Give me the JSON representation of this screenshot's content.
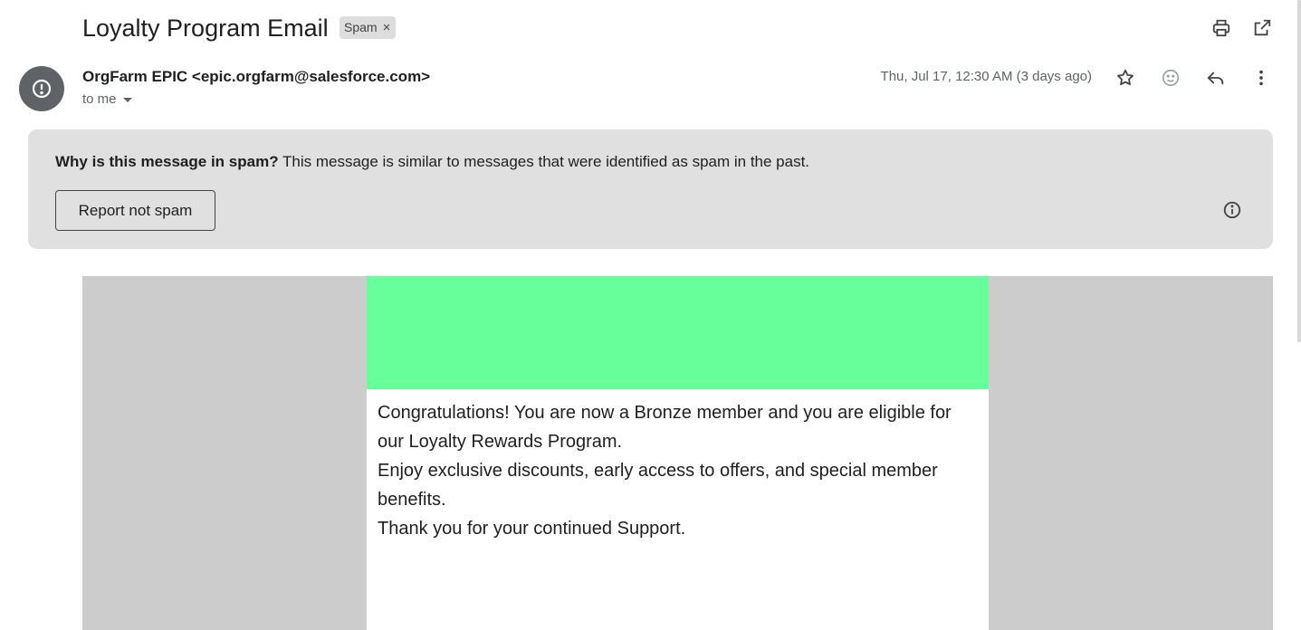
{
  "email": {
    "subject": "Loyalty Program Email",
    "label": "Spam",
    "label_remove": "×",
    "sender": "OrgFarm EPIC <epic.orgfarm@salesforce.com>",
    "recipient": "to me",
    "date": "Thu, Jul 17, 12:30 AM (3 days ago)"
  },
  "spam_banner": {
    "title": "Why is this message in spam?",
    "text": " This message is similar to messages that were identified as spam in the past.",
    "button": "Report not spam"
  },
  "body": {
    "hero_color": "#66ff99",
    "lines": [
      "Congratulations! You are now a Bronze member and you are eligible for our Loyalty Rewards Program.",
      "Enjoy exclusive discounts, early access to offers, and special member benefits.",
      "Thank you for your continued Support."
    ]
  },
  "icons": {
    "print": "printer-icon",
    "open_new": "open-in-new-window-icon",
    "star": "star-icon",
    "emoji": "emoji-reaction-icon",
    "reply": "reply-icon",
    "more": "more-vert-icon",
    "avatar": "spam-warning-icon",
    "expand": "chevron-down-icon",
    "info": "info-icon"
  }
}
